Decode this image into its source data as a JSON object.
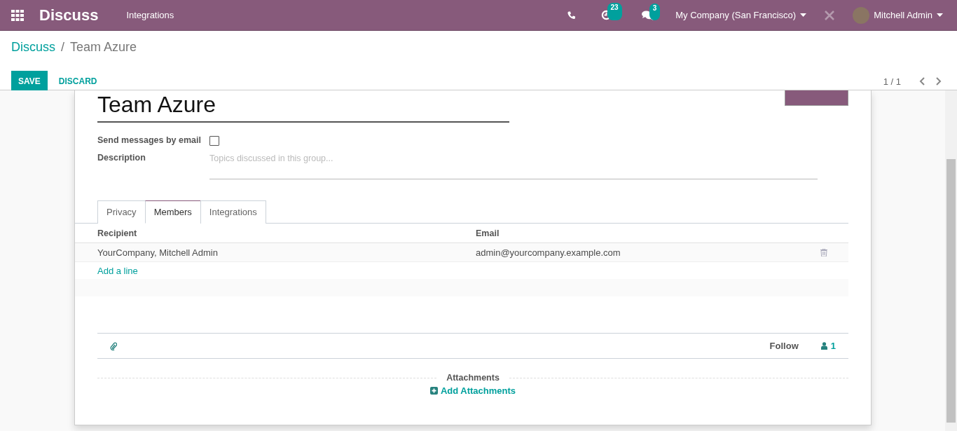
{
  "navbar": {
    "app_name": "Discuss",
    "menu": [
      "Integrations"
    ],
    "activity_count": "23",
    "message_count": "3",
    "company": "My Company (San Francisco)",
    "user": "Mitchell Admin"
  },
  "breadcrumb": {
    "parent": "Discuss",
    "separator": "/",
    "current": "Team Azure"
  },
  "actions": {
    "save": "SAVE",
    "discard": "DISCARD",
    "pager": "1 / 1"
  },
  "form": {
    "name": "Team Azure",
    "fields": [
      {
        "label": "Send messages by email",
        "kind": "checkbox",
        "checked": false
      },
      {
        "label": "Description",
        "kind": "textarea",
        "placeholder": "Topics discussed in this group..."
      }
    ],
    "tabs": [
      {
        "label": "Privacy",
        "selected": false
      },
      {
        "label": "Members",
        "selected": true
      },
      {
        "label": "Integrations",
        "selected": false
      }
    ],
    "table": {
      "columns": [
        "Recipient",
        "Email"
      ],
      "rows": [
        {
          "recipient": "YourCompany, Mitchell Admin",
          "email": "admin@yourcompany.example.com"
        }
      ],
      "add_line": "Add a line"
    }
  },
  "chatter": {
    "follow": "Follow",
    "followers": "1",
    "attachments_title": "Attachments",
    "add_attachments": "Add Attachments"
  }
}
